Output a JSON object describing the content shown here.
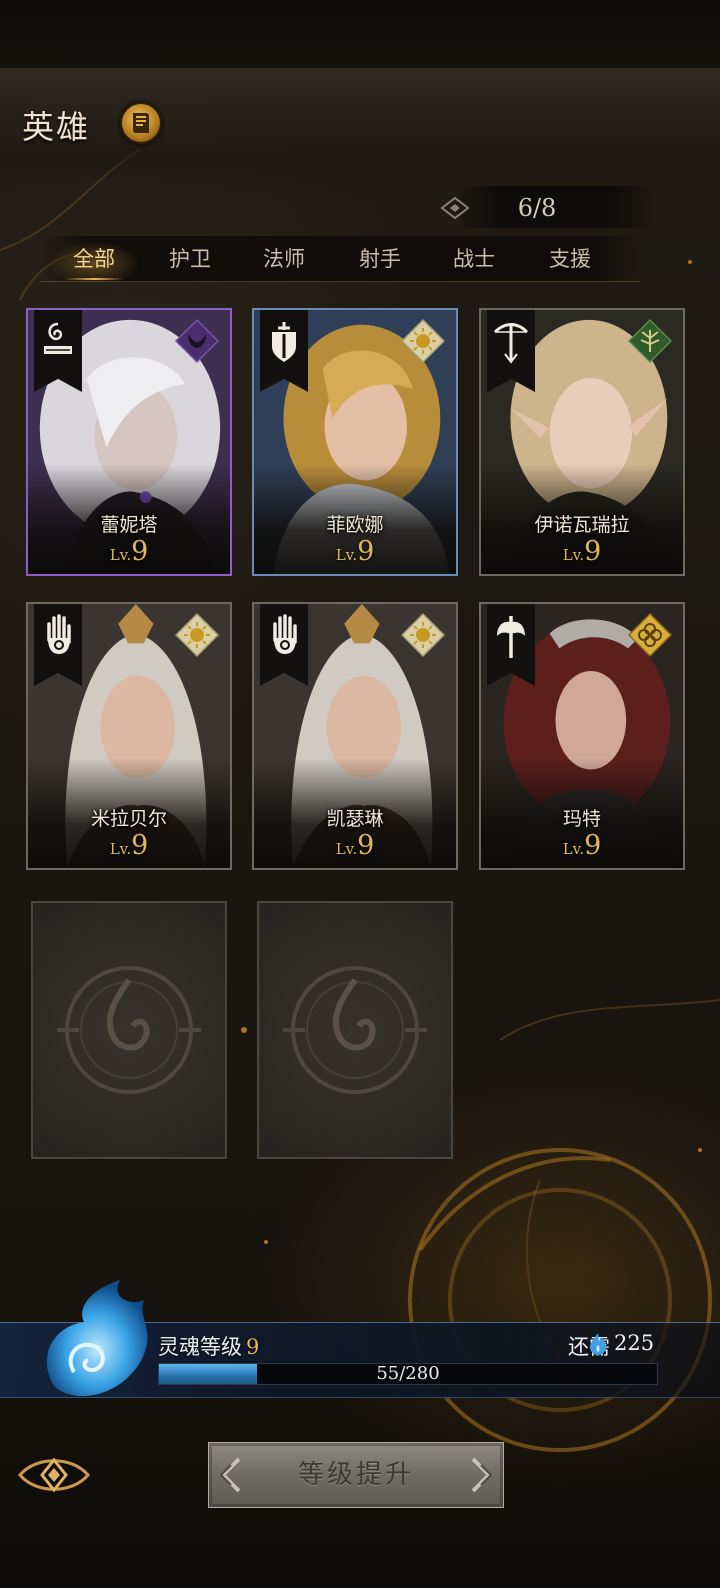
{
  "header": {
    "title": "英雄",
    "book_icon": "codex-book-icon",
    "hero_count": "6/8"
  },
  "tabs": [
    {
      "label": "全部",
      "active": true
    },
    {
      "label": "护卫",
      "active": false
    },
    {
      "label": "法师",
      "active": false
    },
    {
      "label": "射手",
      "active": false
    },
    {
      "label": "战士",
      "active": false
    },
    {
      "label": "支援",
      "active": false
    }
  ],
  "heroes": [
    {
      "name": "蕾妮塔",
      "lv_label": "Lv.",
      "level": "9",
      "role_icon": "spellbook-icon",
      "element_icon": "shadow-horns-icon",
      "frame_color": "#8e5dc9"
    },
    {
      "name": "菲欧娜",
      "lv_label": "Lv.",
      "level": "9",
      "role_icon": "sword-shield-icon",
      "element_icon": "sun-icon",
      "frame_color": "#6c8bb4"
    },
    {
      "name": "伊诺瓦瑞拉",
      "lv_label": "Lv.",
      "level": "9",
      "role_icon": "bow-arrow-icon",
      "element_icon": "nature-tree-icon",
      "frame_color": "#6d6860"
    },
    {
      "name": "米拉贝尔",
      "lv_label": "Lv.",
      "level": "9",
      "role_icon": "healing-hand-icon",
      "element_icon": "sun-icon",
      "frame_color": "#6d6860"
    },
    {
      "name": "凯瑟琳",
      "lv_label": "Lv.",
      "level": "9",
      "role_icon": "healing-hand-icon",
      "element_icon": "sun-icon",
      "frame_color": "#6d6860"
    },
    {
      "name": "玛特",
      "lv_label": "Lv.",
      "level": "9",
      "role_icon": "battle-axe-icon",
      "element_icon": "gold-sigil-icon",
      "frame_color": "#6d6860"
    }
  ],
  "empty_slots": [
    {
      "icon": "locked-flame-emblem-icon"
    },
    {
      "icon": "locked-flame-emblem-icon"
    }
  ],
  "soul": {
    "label": "灵魂等级",
    "level": "9",
    "need_label": "还需",
    "need_icon": "blue-soul-flame-icon",
    "need_value": "225",
    "progress_text": "55/280",
    "progress_fraction": 0.196
  },
  "footer": {
    "nav_icon": "eye-sigil-icon",
    "upgrade_label": "等级提升",
    "upgrade_enabled": false
  },
  "colors": {
    "accent_gold": "#e2b65e",
    "soul_blue": "#2b78b4",
    "tab_active": "#f4d894"
  }
}
